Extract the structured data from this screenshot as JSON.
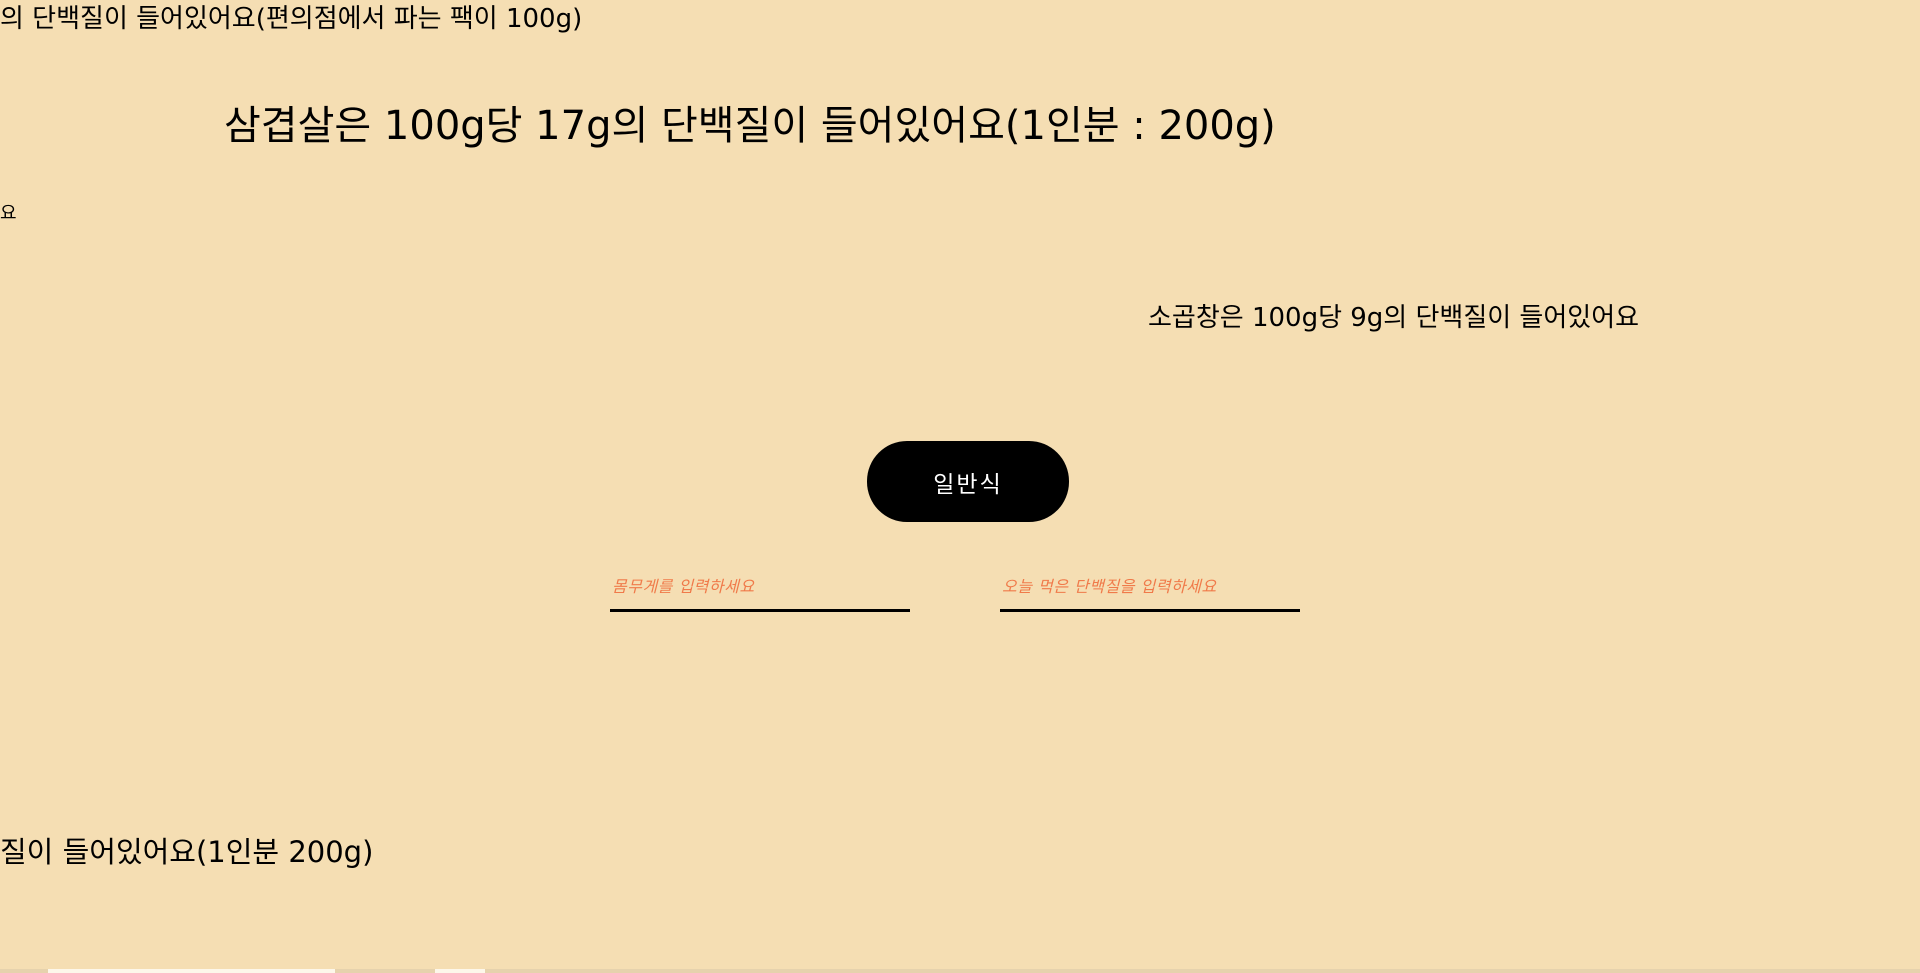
{
  "floating_texts": {
    "chicken_breast": "의 단백질이 들어있어요(편의점에서 파는 팩이 100g)",
    "pork_belly": "삼겹살은 100g당 17g의 단백질이 들어있어요(1인분 : 200g)",
    "egg": "요",
    "gopchang": "소곱창은 100g당 9g의 단백질이 들어있어요",
    "beef": "질이 들어있어요(1인분 200g)"
  },
  "diet_button": {
    "label": "일반식"
  },
  "inputs": {
    "weight": {
      "placeholder": "몸무게를 입력하세요",
      "value": ""
    },
    "protein": {
      "placeholder": "오늘 먹은 단백질을 입력하세요",
      "value": ""
    }
  },
  "colors": {
    "background": "#f5deb3",
    "button_bg": "#000000",
    "button_text": "#ffffff",
    "placeholder": "#f07a4a",
    "underline": "#000000"
  }
}
